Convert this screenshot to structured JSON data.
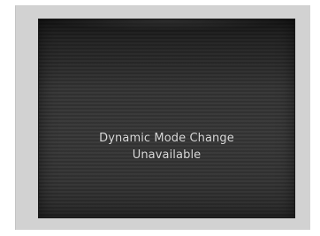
{
  "screen": {
    "message_line1": "Dynamic Mode Change",
    "message_line2": "Unavailable"
  },
  "colors": {
    "panel_background": "#d2d2d2",
    "screen_background": "#353535",
    "text": "#dcdcdc"
  }
}
